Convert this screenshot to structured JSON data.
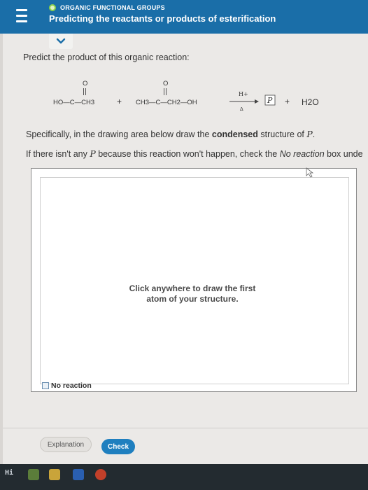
{
  "header": {
    "section": "ORGANIC FUNCTIONAL GROUPS",
    "title": "Predicting the reactants or products of esterification"
  },
  "question": {
    "prompt": "Predict the product of this organic reaction:",
    "reaction": {
      "reactant1": "HO—C—CH3",
      "plus1": "+",
      "reactant2": "CH3—C—CH2—OH",
      "condition_top": "H+",
      "condition_bottom": "Δ",
      "product": "P",
      "plus2": "+",
      "byproduct": "H2O"
    },
    "specifically_before": "Specifically, in the drawing area below draw the ",
    "specifically_bold": "condensed",
    "specifically_after": " structure of ",
    "specifically_var": "P",
    "specifically_end": ".",
    "noreaction_before": "If there isn't any ",
    "noreaction_var": "P",
    "noreaction_mid": " because this reaction won't happen, check the ",
    "noreaction_italic": "No reaction",
    "noreaction_after": " box unde"
  },
  "drawing": {
    "hint_line1": "Click anywhere to draw the first",
    "hint_line2": "atom of your structure."
  },
  "no_reaction_label": "No reaction",
  "buttons": {
    "explanation": "Explanation",
    "check": "Check"
  },
  "taskbar": {
    "search_glyph": "Hi"
  },
  "colors": {
    "header_blue": "#1a6ea8",
    "check_blue": "#1f7fbf",
    "section_dot_green": "#8bd14a"
  }
}
